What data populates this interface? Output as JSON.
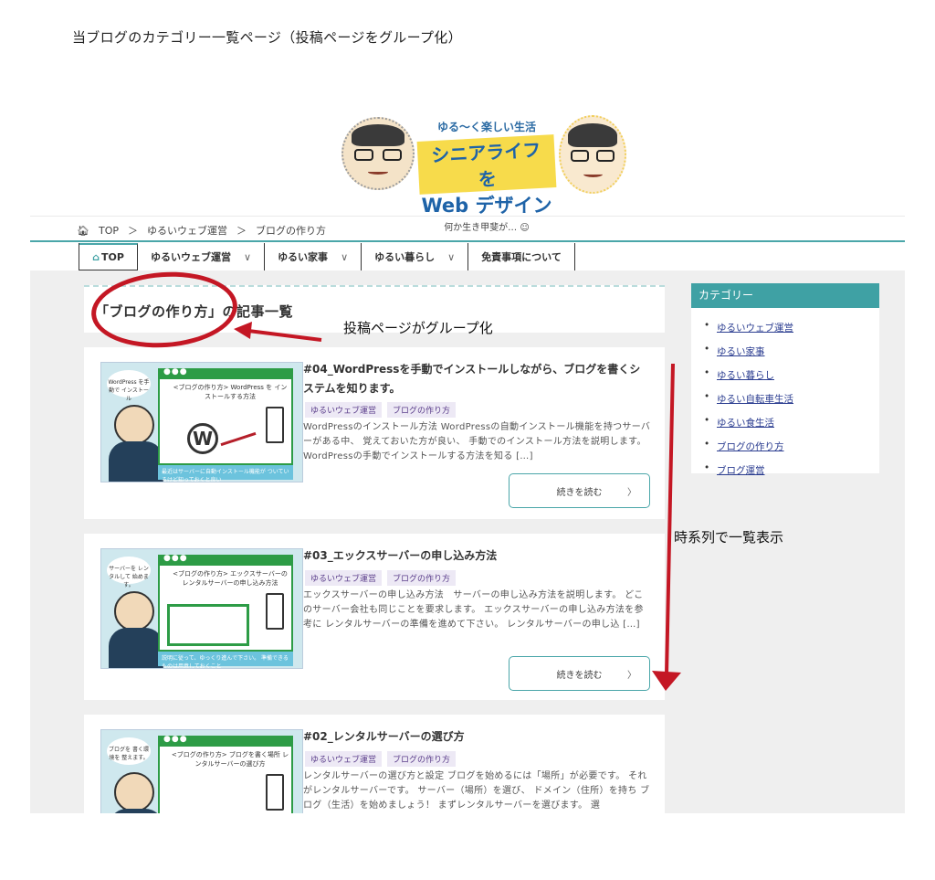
{
  "caption": "当ブログのカテゴリー一覧ページ（投稿ページをグループ化）",
  "logo": {
    "sub": "ゆる〜く楽しい生活",
    "main1": "シニアライフを",
    "main2": "Web デザイン",
    "foot": "何か生き甲斐が… ☺"
  },
  "breadcrumb": {
    "home": "TOP",
    "items": [
      "ゆるいウェブ運営",
      "ブログの作り方"
    ],
    "separator": "＞"
  },
  "nav": {
    "items": [
      {
        "label": "TOP",
        "icon": "home-icon"
      },
      {
        "label": "ゆるいウェブ運営",
        "has_dropdown": true
      },
      {
        "label": "ゆるい家事",
        "has_dropdown": true
      },
      {
        "label": "ゆるい暮らし",
        "has_dropdown": true
      },
      {
        "label": "免責事項について",
        "has_dropdown": false
      }
    ]
  },
  "archive": {
    "heading": "「ブログの作り方」の記事一覧"
  },
  "sidebar": {
    "title": "カテゴリー",
    "categories": [
      "ゆるいウェブ運営",
      "ゆるい家事",
      "ゆるい暮らし",
      "ゆるい自転車生活",
      "ゆるい食生活",
      "ブログの作り方",
      "ブログ運営"
    ]
  },
  "posts": [
    {
      "title": "#04_WordPressを手動でインストールしながら、ブログを書くシステムを知ります。",
      "tags": [
        "ゆるいウェブ運営",
        "ブログの作り方"
      ],
      "excerpt": "WordPressのインストール方法 WordPressの自動インストール機能を持つサーバーがある中、 覚えておいた方が良い、 手動でのインストール方法を説明します。 WordPressの手動でインストールする方法を知る […]",
      "more": "続きを読む",
      "thumb": {
        "bubble": "WordPress を手動で インストール",
        "caption": "<ブログの作り方> WordPress を インストールする方法",
        "bottom": "最近はサーバーに自動インストール機能が ついているけど知っておくと良い"
      }
    },
    {
      "title": "#03_エックスサーバーの申し込み方法",
      "tags": [
        "ゆるいウェブ運営",
        "ブログの作り方"
      ],
      "excerpt": "エックスサーバーの申し込み方法　サーバーの申し込み方法を説明します。 どこのサーバー会社も同じことを要求します。 エックスサーバーの申し込み方法を参考に レンタルサーバーの準備を進めて下さい。 レンタルサーバーの申し込 […]",
      "more": "続きを読む",
      "thumb": {
        "bubble": "サーバーを レンタルして 始めます。",
        "caption": "<ブログの作り方> エックスサーバーの レンタルサーバーの申し込み方法",
        "bottom": "説明に従って、ゆっくり進んで下さい。 準備できるものは用意しておくこと"
      }
    },
    {
      "title": "#02_レンタルサーバーの選び方",
      "tags": [
        "ゆるいウェブ運営",
        "ブログの作り方"
      ],
      "excerpt": "レンタルサーバーの選び方と設定 ブログを始めるには「場所」が必要です。 それがレンタルサーバーです。 サーバー（場所）を選び、 ドメイン（住所）を持ち ブログ（生活）を始めましょう！ まずレンタルサーバーを選びます。 選",
      "thumb": {
        "bubble": "ブログを 書く環境を 整えます。",
        "caption": "<ブログの作り方> ブログを書く場所 レンタルサーバーの選び方",
        "bottom": ""
      }
    }
  ],
  "annotations": {
    "group_label": "投稿ページがグループ化",
    "timeline_label": "時系列で一覧表示",
    "color": "#c41724"
  }
}
